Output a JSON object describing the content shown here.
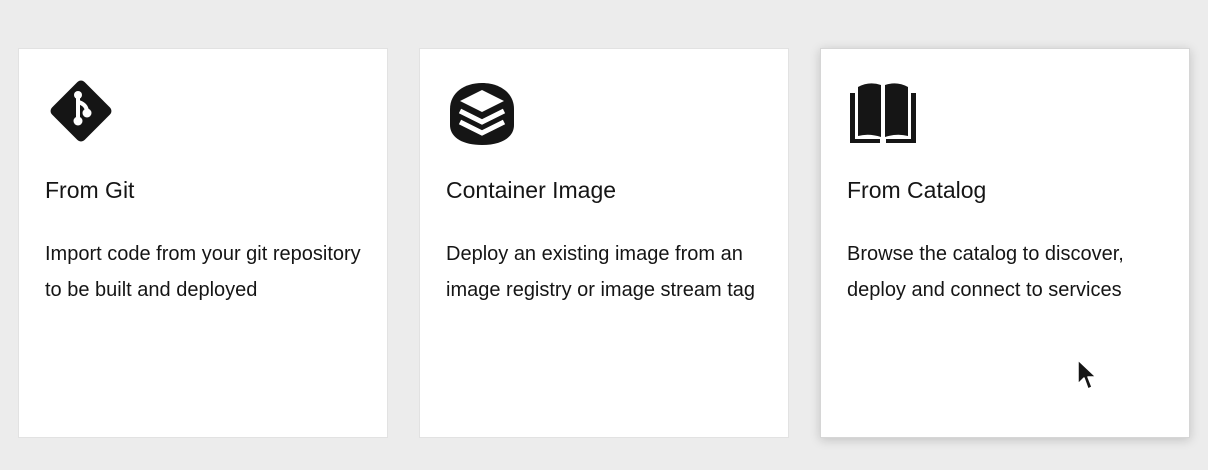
{
  "cards": [
    {
      "icon": "git-icon",
      "title": "From Git",
      "description": "Import code from your git repository to be built and deployed"
    },
    {
      "icon": "layers-icon",
      "title": "Container Image",
      "description": "Deploy an existing image from an image registry or image stream tag"
    },
    {
      "icon": "book-icon",
      "title": "From Catalog",
      "description": "Browse the catalog to discover, deploy and connect to services"
    }
  ],
  "colors": {
    "background": "#ececec",
    "card": "#ffffff",
    "text": "#151515",
    "icon": "#151515"
  },
  "state": {
    "hovered_card": "From Catalog"
  }
}
